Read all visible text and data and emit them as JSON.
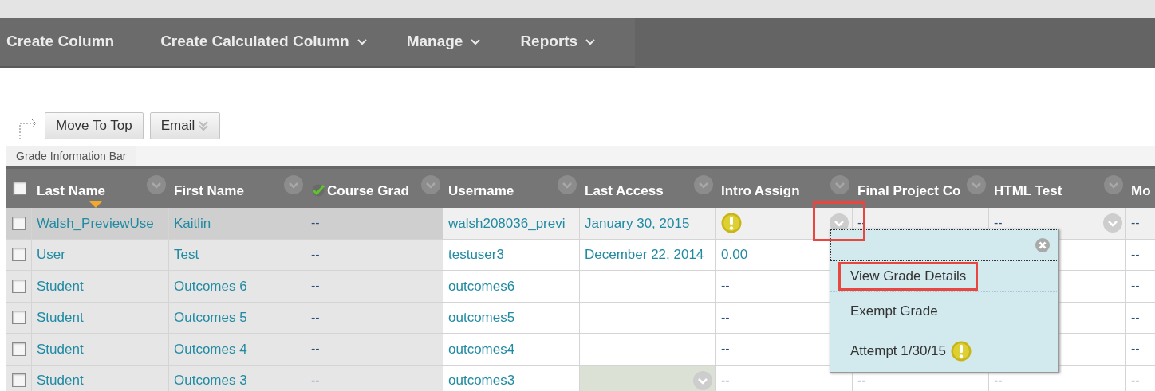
{
  "toolbar": {
    "menus": [
      {
        "label": "Create Column",
        "has_menu": false
      },
      {
        "label": "Create Calculated Column",
        "has_menu": true
      },
      {
        "label": "Manage",
        "has_menu": true
      },
      {
        "label": "Reports",
        "has_menu": true
      }
    ]
  },
  "actions": [
    {
      "label": "Move To Top",
      "has_menu": false
    },
    {
      "label": "Email",
      "has_menu": true
    }
  ],
  "info_bar": {
    "label": "Grade Information Bar"
  },
  "table": {
    "header_checked": false,
    "columns": [
      {
        "label": "Last Name",
        "sorted": true,
        "external_grade": false,
        "menu": true
      },
      {
        "label": "First Name",
        "sorted": false,
        "external_grade": false,
        "menu": true
      },
      {
        "label": "Course Grad",
        "sorted": false,
        "external_grade": true,
        "menu": true
      },
      {
        "label": "Username",
        "sorted": false,
        "external_grade": false,
        "menu": true
      },
      {
        "label": "Last Access",
        "sorted": false,
        "external_grade": false,
        "menu": true
      },
      {
        "label": "Intro Assign",
        "sorted": false,
        "external_grade": false,
        "menu": true
      },
      {
        "label": "Final Project Co",
        "sorted": false,
        "external_grade": false,
        "menu": true
      },
      {
        "label": "HTML Test",
        "sorted": false,
        "external_grade": false,
        "menu": true
      },
      {
        "label": "Mo",
        "sorted": false,
        "external_grade": false,
        "menu": false
      }
    ],
    "rows": [
      {
        "checked": false,
        "highlighted": true,
        "cells": [
          {
            "kind": "link",
            "text": "Walsh_PreviewUse"
          },
          {
            "kind": "link",
            "text": "Kaitlin"
          },
          {
            "kind": "plain",
            "text": "--"
          },
          {
            "kind": "link",
            "text": "walsh208036_previ"
          },
          {
            "kind": "link",
            "text": "January 30, 2015"
          },
          {
            "kind": "warning",
            "menu": true,
            "callout": true
          },
          {
            "kind": "plain",
            "text": "--"
          },
          {
            "kind": "plain",
            "text": "--",
            "menu": true
          },
          {
            "kind": "plain",
            "text": "--"
          }
        ]
      },
      {
        "checked": false,
        "highlighted": false,
        "cells": [
          {
            "kind": "link",
            "text": "User"
          },
          {
            "kind": "link",
            "text": "Test"
          },
          {
            "kind": "plain",
            "text": "--"
          },
          {
            "kind": "link",
            "text": "testuser3"
          },
          {
            "kind": "link",
            "text": "December 22, 2014"
          },
          {
            "kind": "link",
            "text": "0.00"
          },
          {
            "kind": "covered"
          },
          {
            "kind": "covered"
          },
          {
            "kind": "plain",
            "text": "--"
          }
        ]
      },
      {
        "checked": false,
        "highlighted": false,
        "cells": [
          {
            "kind": "link",
            "text": "Student"
          },
          {
            "kind": "link",
            "text": "Outcomes 6"
          },
          {
            "kind": "plain",
            "text": "--"
          },
          {
            "kind": "link",
            "text": "outcomes6"
          },
          {
            "kind": "blank"
          },
          {
            "kind": "plain",
            "text": "--"
          },
          {
            "kind": "covered"
          },
          {
            "kind": "covered"
          },
          {
            "kind": "plain",
            "text": "--"
          }
        ]
      },
      {
        "checked": false,
        "highlighted": false,
        "cells": [
          {
            "kind": "link",
            "text": "Student"
          },
          {
            "kind": "link",
            "text": "Outcomes 5"
          },
          {
            "kind": "plain",
            "text": "--"
          },
          {
            "kind": "link",
            "text": "outcomes5"
          },
          {
            "kind": "blank"
          },
          {
            "kind": "plain",
            "text": "--"
          },
          {
            "kind": "covered"
          },
          {
            "kind": "covered"
          },
          {
            "kind": "plain",
            "text": "--"
          }
        ]
      },
      {
        "checked": false,
        "highlighted": false,
        "cells": [
          {
            "kind": "link",
            "text": "Student"
          },
          {
            "kind": "link",
            "text": "Outcomes 4"
          },
          {
            "kind": "plain",
            "text": "--"
          },
          {
            "kind": "link",
            "text": "outcomes4"
          },
          {
            "kind": "blank"
          },
          {
            "kind": "plain",
            "text": "--"
          },
          {
            "kind": "covered"
          },
          {
            "kind": "covered"
          },
          {
            "kind": "plain",
            "text": "--"
          }
        ]
      },
      {
        "checked": false,
        "highlighted": false,
        "cells": [
          {
            "kind": "link",
            "text": "Student"
          },
          {
            "kind": "link",
            "text": "Outcomes 3"
          },
          {
            "kind": "plain",
            "text": "--"
          },
          {
            "kind": "link",
            "text": "outcomes3"
          },
          {
            "kind": "blank",
            "active": true,
            "menu": true
          },
          {
            "kind": "plain",
            "text": "--"
          },
          {
            "kind": "plain",
            "text": "--"
          },
          {
            "kind": "plain",
            "text": "--"
          },
          {
            "kind": "plain",
            "text": "--"
          }
        ]
      }
    ]
  },
  "popup": {
    "items": [
      {
        "kind": "action",
        "label": "View Grade Details",
        "callout": true
      },
      {
        "kind": "action",
        "label": "Exempt Grade",
        "callout": false
      },
      {
        "kind": "attempt",
        "label": "Attempt 1/30/15",
        "callout": false
      }
    ]
  }
}
